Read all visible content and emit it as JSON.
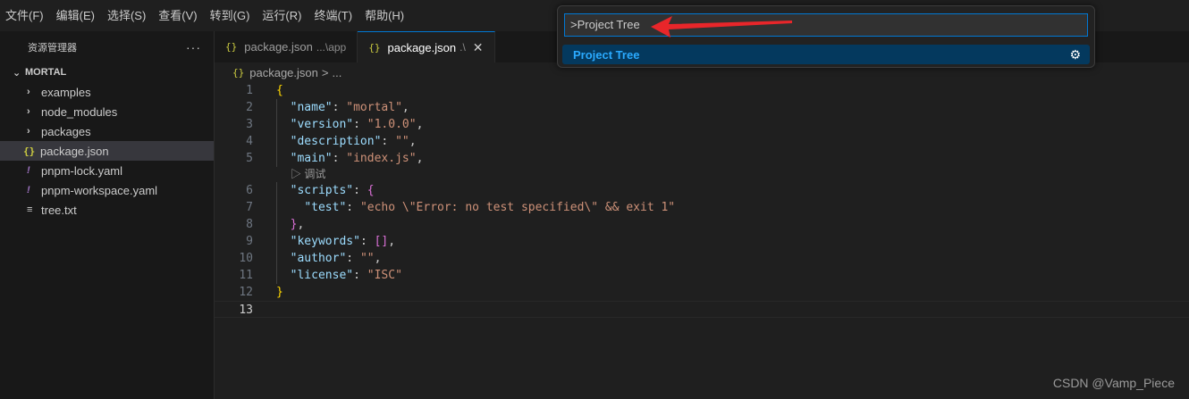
{
  "menubar": {
    "items": [
      "文件(F)",
      "编辑(E)",
      "选择(S)",
      "查看(V)",
      "转到(G)",
      "运行(R)",
      "终端(T)",
      "帮助(H)"
    ]
  },
  "sidebar": {
    "title": "资源管理器",
    "more": "···",
    "section": "MORTAL",
    "items": [
      {
        "label": "examples",
        "kind": "folder"
      },
      {
        "label": "node_modules",
        "kind": "folder"
      },
      {
        "label": "packages",
        "kind": "folder"
      },
      {
        "label": "package.json",
        "kind": "json",
        "selected": true
      },
      {
        "label": "pnpm-lock.yaml",
        "kind": "yaml"
      },
      {
        "label": "pnpm-workspace.yaml",
        "kind": "yaml"
      },
      {
        "label": "tree.txt",
        "kind": "txt"
      }
    ]
  },
  "tabs": [
    {
      "label": "package.json",
      "desc": "...\\app",
      "active": false
    },
    {
      "label": "package.json",
      "desc": ".\\",
      "active": true
    }
  ],
  "breadcrumb": {
    "file": "package.json",
    "sep": ">",
    "rest": "..."
  },
  "editor": {
    "json_icon": "{}",
    "codelens": "调试",
    "current_line": 13
  },
  "palette": {
    "input_value": ">Project Tree",
    "result": "Project Tree"
  },
  "colors": {
    "accent": "#0078d4",
    "annotation_arrow": "#e8262a",
    "result_highlight": "#2aaaff"
  },
  "watermark": "CSDN @Vamp_Piece"
}
